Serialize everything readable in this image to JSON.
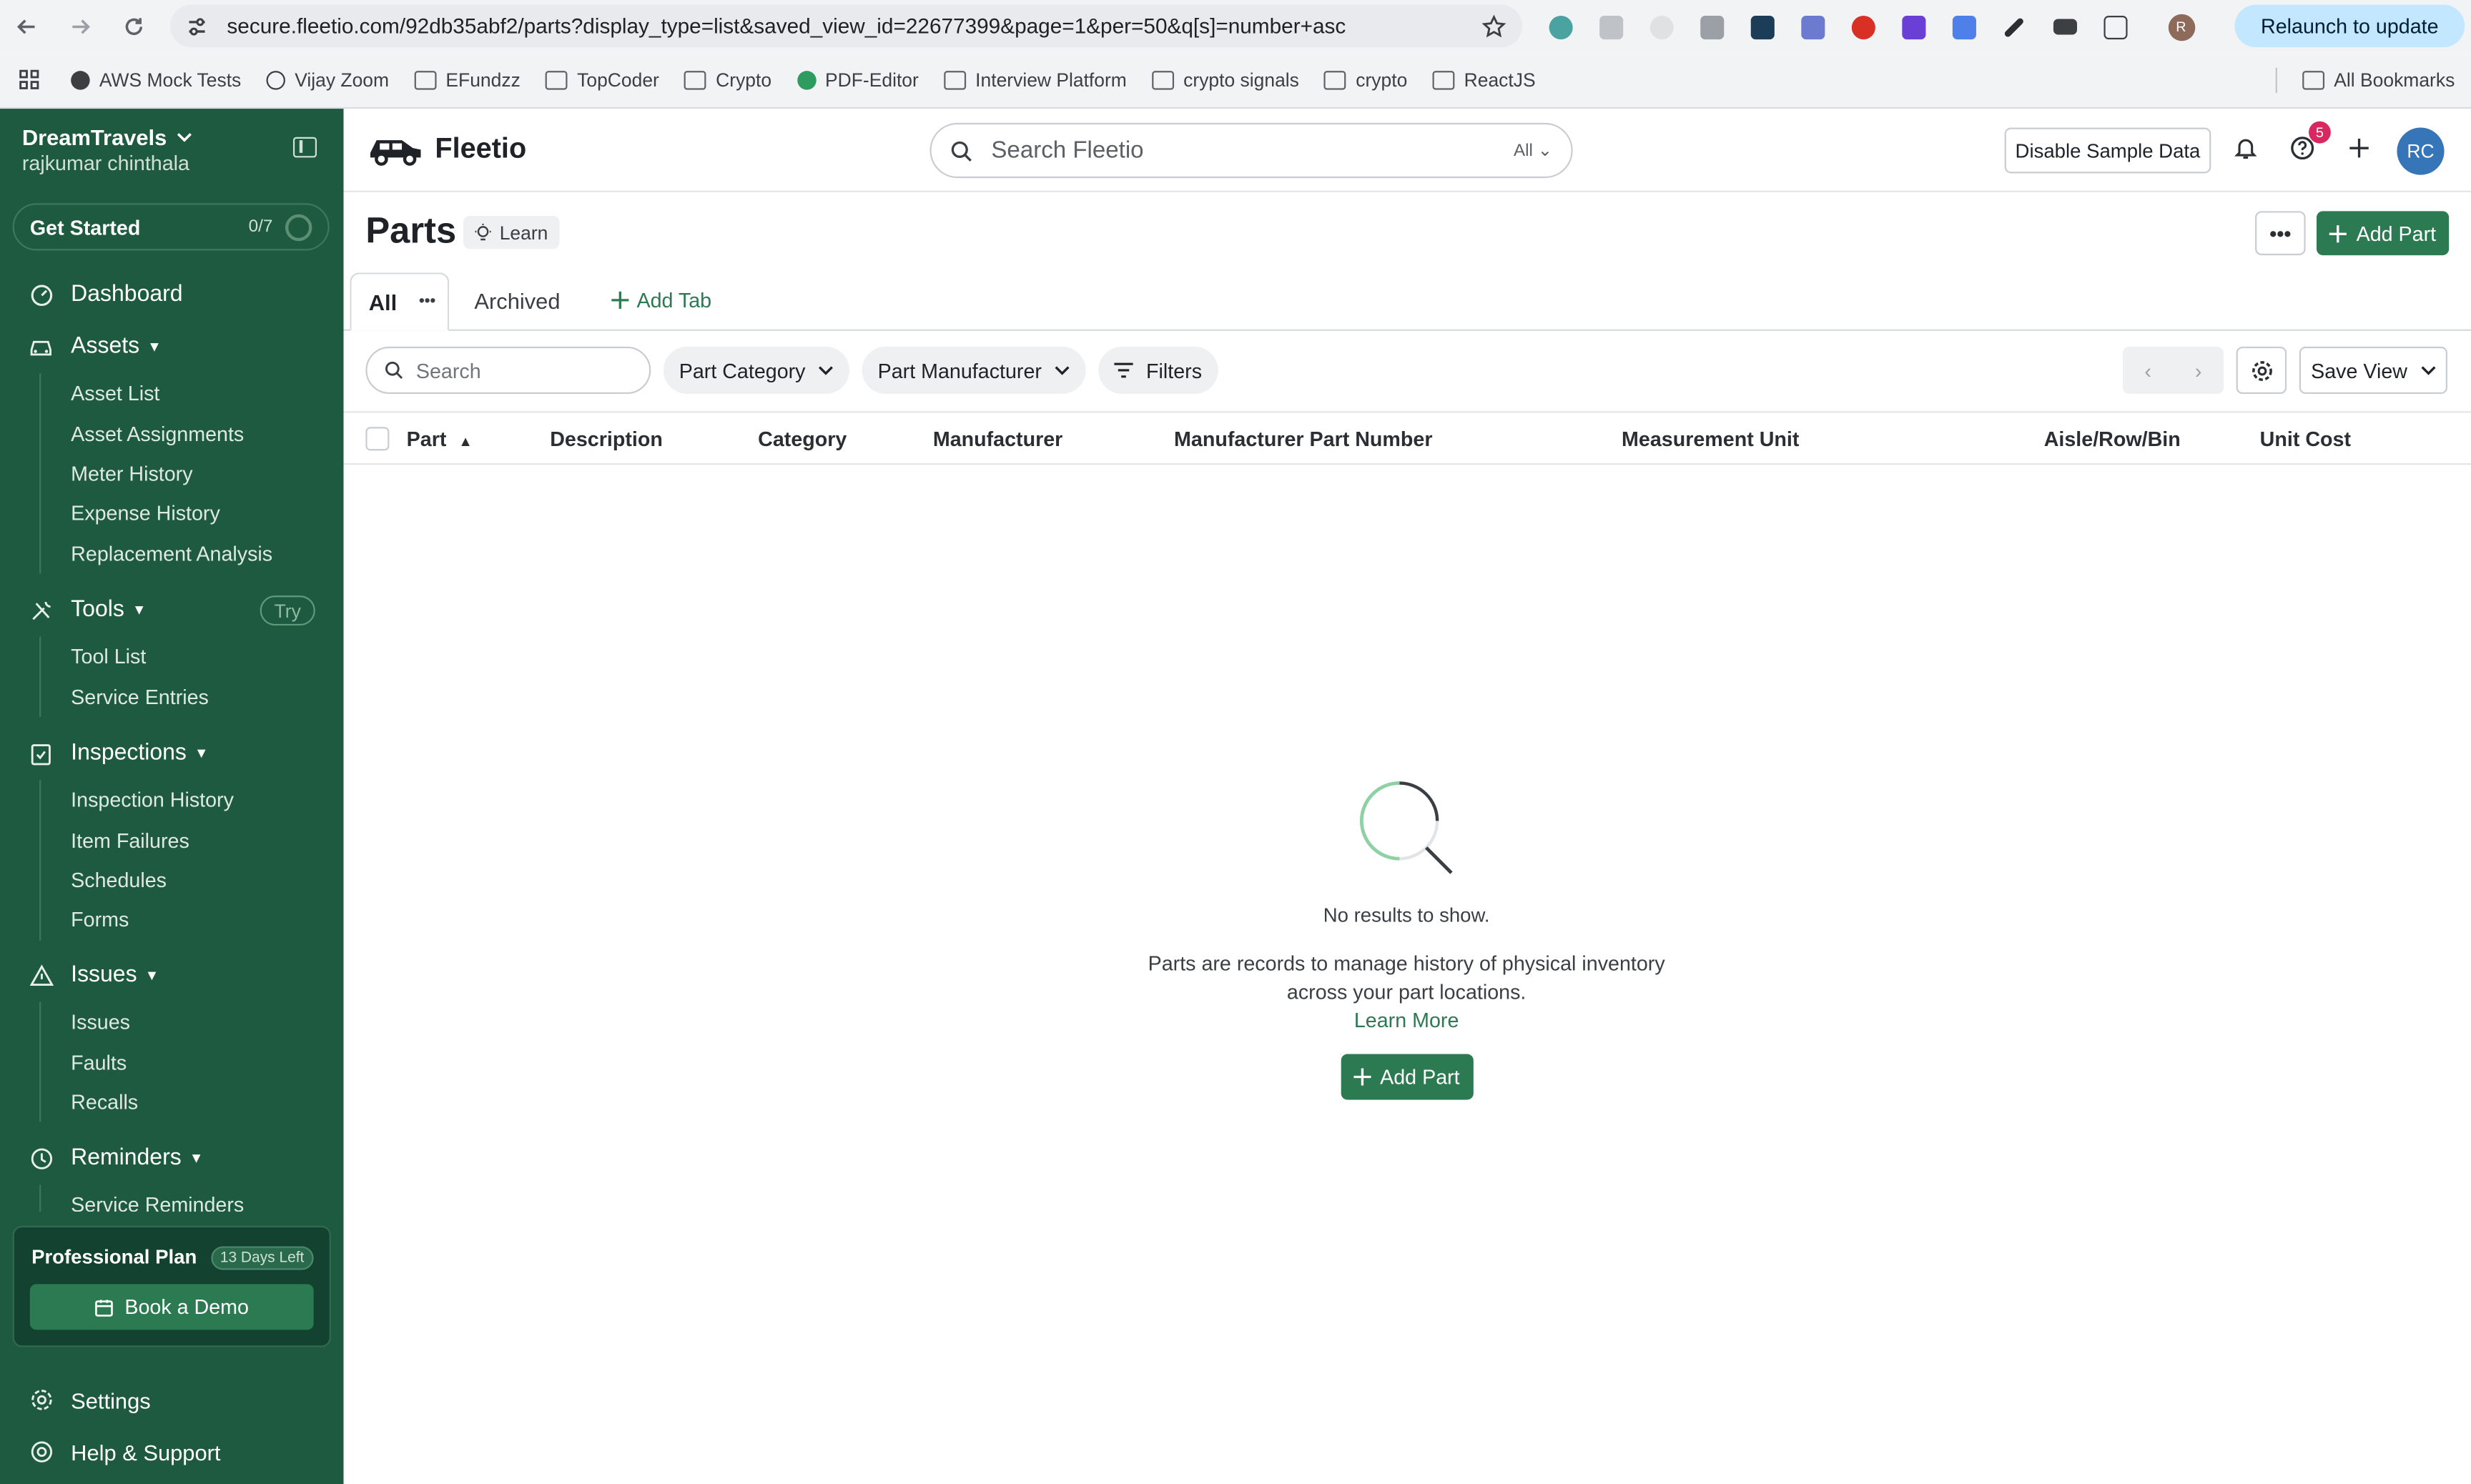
{
  "browser": {
    "url": "secure.fleetio.com/92db35abf2/parts?display_type=list&saved_view_id=22677399&page=1&per=50&q[s]=number+asc",
    "relaunch_label": "Relaunch to update",
    "profile_initial": "R",
    "bookmarks": [
      "AWS Mock Tests",
      "Vijay Zoom",
      "EFundzz",
      "TopCoder",
      "Crypto",
      "PDF-Editor",
      "Interview Platform",
      "crypto signals",
      "crypto",
      "ReactJS"
    ],
    "all_bookmarks": "All Bookmarks"
  },
  "sidebar": {
    "org_name": "DreamTravels",
    "user_name": "rajkumar chinthala",
    "get_started": {
      "label": "Get Started",
      "progress": "0/7"
    },
    "sections": [
      {
        "title": "Dashboard"
      },
      {
        "title": "Assets",
        "items": [
          "Asset List",
          "Asset Assignments",
          "Meter History",
          "Expense History",
          "Replacement Analysis"
        ]
      },
      {
        "title": "Tools",
        "badge": "Try",
        "items": [
          "Tool List",
          "Service Entries"
        ]
      },
      {
        "title": "Inspections",
        "items": [
          "Inspection History",
          "Item Failures",
          "Schedules",
          "Forms"
        ]
      },
      {
        "title": "Issues",
        "items": [
          "Issues",
          "Faults",
          "Recalls"
        ]
      },
      {
        "title": "Reminders",
        "items": [
          "Service Reminders"
        ]
      }
    ],
    "plan": {
      "title": "Professional Plan",
      "days_left": "13 Days Left",
      "demo_label": "Book a Demo"
    },
    "settings_label": "Settings",
    "help_label": "Help & Support"
  },
  "topbar": {
    "logo_text": "Fleetio",
    "search_placeholder": "Search Fleetio",
    "search_scope": "All",
    "disable_sample_label": "Disable Sample Data",
    "help_badge": "5",
    "avatar_initials": "RC"
  },
  "page": {
    "title": "Parts",
    "learn_label": "Learn",
    "more_label": "•••",
    "add_part_label": "Add Part",
    "tabs": {
      "all": "All",
      "archived": "Archived",
      "add_tab": "Add Tab"
    },
    "filters": {
      "search_placeholder": "Search",
      "part_category": "Part Category",
      "part_manufacturer": "Part Manufacturer",
      "filters_label": "Filters",
      "save_view": "Save View"
    },
    "columns": [
      "Part",
      "Description",
      "Category",
      "Manufacturer",
      "Manufacturer Part Number",
      "Measurement Unit",
      "Aisle/Row/Bin",
      "Unit Cost"
    ],
    "empty": {
      "message": "No results to show.",
      "description_line1": "Parts are records to manage history of physical inventory",
      "description_line2": "across your part locations.",
      "learn_more": "Learn More",
      "add_part_label": "Add Part"
    }
  },
  "colors": {
    "sidebar_bg": "#1e5a3f",
    "primary_green": "#2c7a52",
    "avatar_blue": "#3675b8",
    "badge_pink": "#d9285f"
  }
}
